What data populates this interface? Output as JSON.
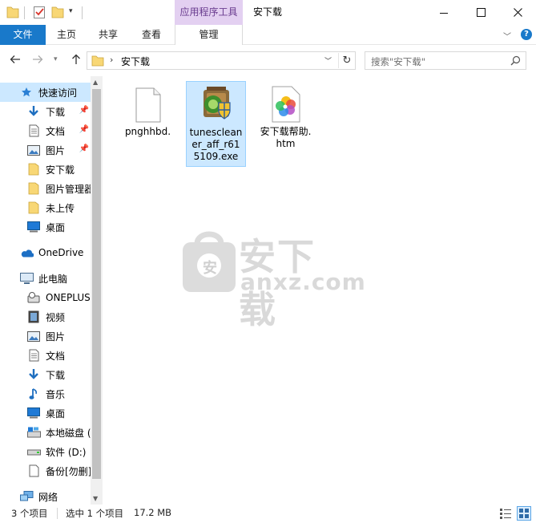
{
  "titlebar": {
    "contextual_tab_header": "应用程序工具",
    "window_title": "安下载"
  },
  "ribbon": {
    "tabs": [
      "文件",
      "主页",
      "共享",
      "查看",
      "管理"
    ]
  },
  "address": {
    "path": "安下载",
    "search_placeholder": "搜索\"安下载\""
  },
  "sidebar": {
    "items": [
      {
        "label": "快速访问",
        "icon": "star-icon"
      },
      {
        "label": "下载",
        "icon": "download-arrow-icon",
        "pinned": true
      },
      {
        "label": "文档",
        "icon": "document-icon",
        "pinned": true
      },
      {
        "label": "图片",
        "icon": "pictures-icon",
        "pinned": true
      },
      {
        "label": "安下载",
        "icon": "folder-icon"
      },
      {
        "label": "图片管理器",
        "icon": "folder-icon"
      },
      {
        "label": "未上传",
        "icon": "folder-icon"
      },
      {
        "label": "桌面",
        "icon": "desktop-icon"
      },
      {
        "label": "OneDrive",
        "icon": "cloud-icon"
      },
      {
        "label": "此电脑",
        "icon": "computer-icon"
      },
      {
        "label": "ONEPLUS",
        "icon": "device-icon"
      },
      {
        "label": "视频",
        "icon": "video-icon"
      },
      {
        "label": "图片",
        "icon": "pictures-icon"
      },
      {
        "label": "文档",
        "icon": "document-icon"
      },
      {
        "label": "下载",
        "icon": "download-arrow-icon"
      },
      {
        "label": "音乐",
        "icon": "music-icon"
      },
      {
        "label": "桌面",
        "icon": "desktop-icon"
      },
      {
        "label": "本地磁盘 (",
        "icon": "drive-c-icon"
      },
      {
        "label": "软件 (D:)",
        "icon": "drive-icon"
      },
      {
        "label": "备份[勿删]",
        "icon": "drive-file-icon"
      },
      {
        "label": "网络",
        "icon": "network-icon"
      }
    ]
  },
  "files": [
    {
      "name": "pnghhbd.",
      "icon": "blank-file-icon",
      "selected": false
    },
    {
      "name": "tunescleaner_aff_r615109.exe",
      "icon": "installer-icon",
      "selected": true
    },
    {
      "name": "安下载帮助.htm",
      "icon": "htm-file-icon",
      "selected": false
    }
  ],
  "watermark": {
    "main": "安下载",
    "sub": "anxz.com",
    "badge": "安"
  },
  "status": {
    "item_count": "3 个项目",
    "selected": "选中 1 个项目",
    "size": "17.2 MB"
  },
  "colors": {
    "accent": "#1979ca",
    "selection": "#cce8ff",
    "contextual_tab": "#e3d0f1",
    "folder": "#f8d775"
  }
}
